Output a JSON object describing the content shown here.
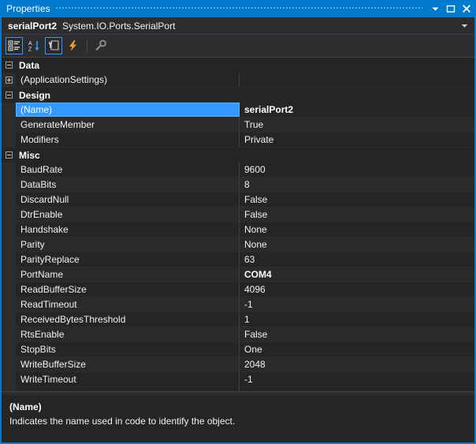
{
  "window": {
    "title": "Properties",
    "controls": [
      {
        "name": "window-dropdown-button",
        "icon": "chevron-down-icon"
      },
      {
        "name": "maximize-button",
        "icon": "maximize-icon"
      },
      {
        "name": "close-button",
        "icon": "close-icon"
      }
    ]
  },
  "object_header": {
    "name": "serialPort2",
    "type": "System.IO.Ports.SerialPort",
    "dropdown_icon": "chevron-down-icon"
  },
  "toolbar": {
    "buttons": [
      {
        "name": "categorized-button",
        "icon": "categorized-icon",
        "label": "Categorized",
        "selected": true,
        "enabled": true
      },
      {
        "name": "alphabetical-button",
        "icon": "sort-az-icon",
        "label": "Alphabetical",
        "selected": false,
        "enabled": true
      },
      {
        "name": "properties-button",
        "icon": "properties-icon",
        "label": "Properties",
        "selected": true,
        "enabled": true
      },
      {
        "name": "events-button",
        "icon": "events-icon",
        "label": "Events",
        "selected": false,
        "enabled": true
      },
      {
        "name": "property-pages-button",
        "icon": "key-icon",
        "label": "Property Pages",
        "selected": false,
        "enabled": false
      }
    ]
  },
  "grid": {
    "rows": [
      {
        "kind": "category",
        "expander": "minus",
        "name": "Data",
        "value": ""
      },
      {
        "kind": "property",
        "expander": "plus",
        "name": "(ApplicationSettings)",
        "value": ""
      },
      {
        "kind": "category",
        "expander": "minus",
        "name": "Design",
        "value": ""
      },
      {
        "kind": "property",
        "expander": "none",
        "name": "(Name)",
        "value": "serialPort2",
        "selected": true,
        "bold_value": true
      },
      {
        "kind": "property",
        "expander": "none",
        "name": "GenerateMember",
        "value": "True"
      },
      {
        "kind": "property",
        "expander": "none",
        "name": "Modifiers",
        "value": "Private"
      },
      {
        "kind": "category",
        "expander": "minus",
        "name": "Misc",
        "value": ""
      },
      {
        "kind": "property",
        "expander": "none",
        "name": "BaudRate",
        "value": "9600"
      },
      {
        "kind": "property",
        "expander": "none",
        "name": "DataBits",
        "value": "8"
      },
      {
        "kind": "property",
        "expander": "none",
        "name": "DiscardNull",
        "value": "False"
      },
      {
        "kind": "property",
        "expander": "none",
        "name": "DtrEnable",
        "value": "False"
      },
      {
        "kind": "property",
        "expander": "none",
        "name": "Handshake",
        "value": "None"
      },
      {
        "kind": "property",
        "expander": "none",
        "name": "Parity",
        "value": "None"
      },
      {
        "kind": "property",
        "expander": "none",
        "name": "ParityReplace",
        "value": "63"
      },
      {
        "kind": "property",
        "expander": "none",
        "name": "PortName",
        "value": "COM4",
        "bold_value": true
      },
      {
        "kind": "property",
        "expander": "none",
        "name": "ReadBufferSize",
        "value": "4096"
      },
      {
        "kind": "property",
        "expander": "none",
        "name": "ReadTimeout",
        "value": "-1"
      },
      {
        "kind": "property",
        "expander": "none",
        "name": "ReceivedBytesThreshold",
        "value": "1"
      },
      {
        "kind": "property",
        "expander": "none",
        "name": "RtsEnable",
        "value": "False"
      },
      {
        "kind": "property",
        "expander": "none",
        "name": "StopBits",
        "value": "One"
      },
      {
        "kind": "property",
        "expander": "none",
        "name": "WriteBufferSize",
        "value": "2048"
      },
      {
        "kind": "property",
        "expander": "none",
        "name": "WriteTimeout",
        "value": "-1"
      },
      {
        "kind": "filler",
        "expander": "none",
        "name": "",
        "value": ""
      }
    ]
  },
  "description": {
    "title": "(Name)",
    "text": "Indicates the name used in code to identify the object."
  },
  "colors": {
    "accent": "#007acc",
    "selection": "#3399ff",
    "selection_border": "#5cb0ff",
    "grid_bg": "#252526",
    "chrome_bg": "#2d2d30",
    "text": "#f1f1f1",
    "events_icon": "#f0a030"
  }
}
